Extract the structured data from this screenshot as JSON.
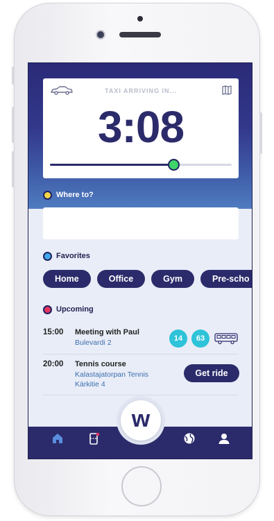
{
  "colors": {
    "primary": "#2b2b6b",
    "accent_green": "#3ed36b",
    "badge_cyan": "#2ec3d8",
    "link_blue": "#3b6fb0",
    "dot_yellow": "#f3d648",
    "dot_blue": "#41a9e8",
    "dot_red": "#e2355f"
  },
  "taxi": {
    "label": "TAXI ARRIVING IN...",
    "countdown": "3:08",
    "progress": 0.68,
    "car_icon": "car-icon",
    "map_icon": "map-icon"
  },
  "where_to": {
    "label": "Where to?",
    "value": "",
    "placeholder": ""
  },
  "favorites": {
    "label": "Favorites",
    "items": [
      "Home",
      "Office",
      "Gym",
      "Pre-scho"
    ]
  },
  "upcoming": {
    "label": "Upcoming",
    "events": [
      {
        "time": "15:00",
        "title": "Meeting with Paul",
        "subtitle": [
          "Bulevardi 2"
        ],
        "badges": [
          "14",
          "63"
        ],
        "icon": "bus-icon"
      },
      {
        "time": "20:00",
        "title": "Tennis course",
        "subtitle": [
          "Kalastajatorpan Tennis",
          "Kärkitie 4"
        ],
        "action_label": "Get ride"
      }
    ]
  },
  "tabbar": {
    "center_logo": "w",
    "items": [
      "home-icon",
      "ticket-icon",
      "globe-icon",
      "profile-icon"
    ],
    "active": "home-icon"
  }
}
